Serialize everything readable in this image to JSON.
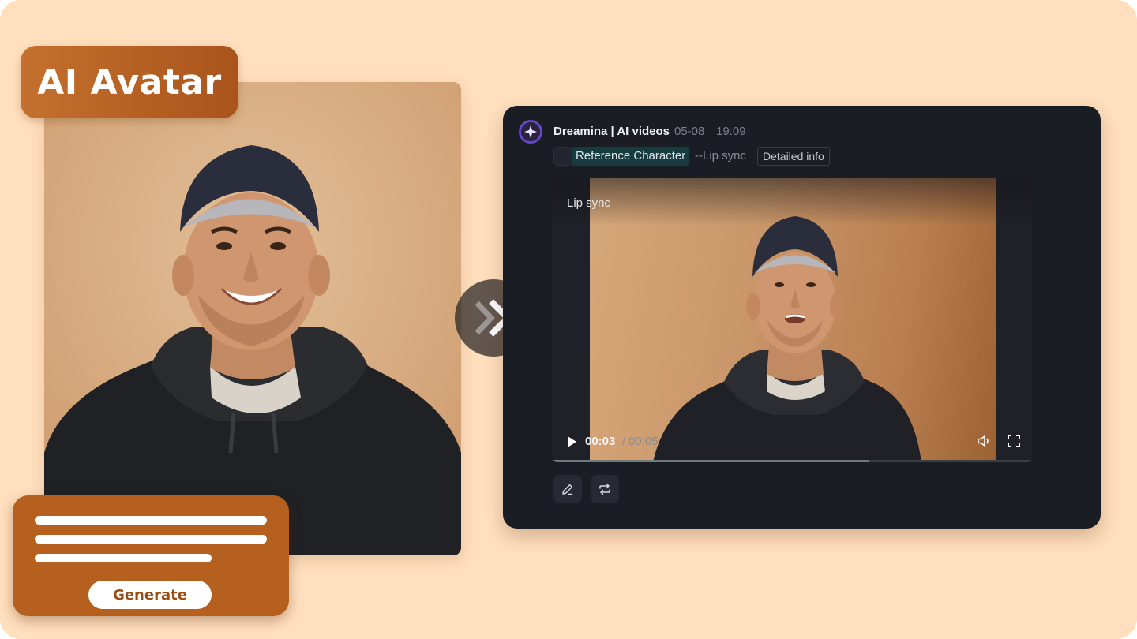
{
  "badge": {
    "title": "AI Avatar"
  },
  "prompt_card": {
    "generate_label": "Generate"
  },
  "result_card": {
    "app_title": "Dreamina | AI videos",
    "date": "05-08",
    "time": "19:09",
    "reference_tag": "Reference Character",
    "mode_tag": "--Lip sync",
    "details_button": "Detailed info"
  },
  "video": {
    "label": "Lip sync",
    "current_time": "00:03",
    "separator": "/",
    "total_time": "00:05",
    "progress": 0.66
  },
  "icons": {
    "arrow": "double-chevron-right-icon",
    "logo": "dreamina-star-icon",
    "play": "play-icon",
    "volume": "volume-icon",
    "fullscreen": "fullscreen-icon",
    "edit": "edit-pencil-icon",
    "regenerate": "repeat-icon"
  },
  "colors": {
    "background": "#ffdfbd",
    "accent": "#b5601f",
    "card_dark": "#1b1d24",
    "tag_highlight": "#163c40"
  }
}
